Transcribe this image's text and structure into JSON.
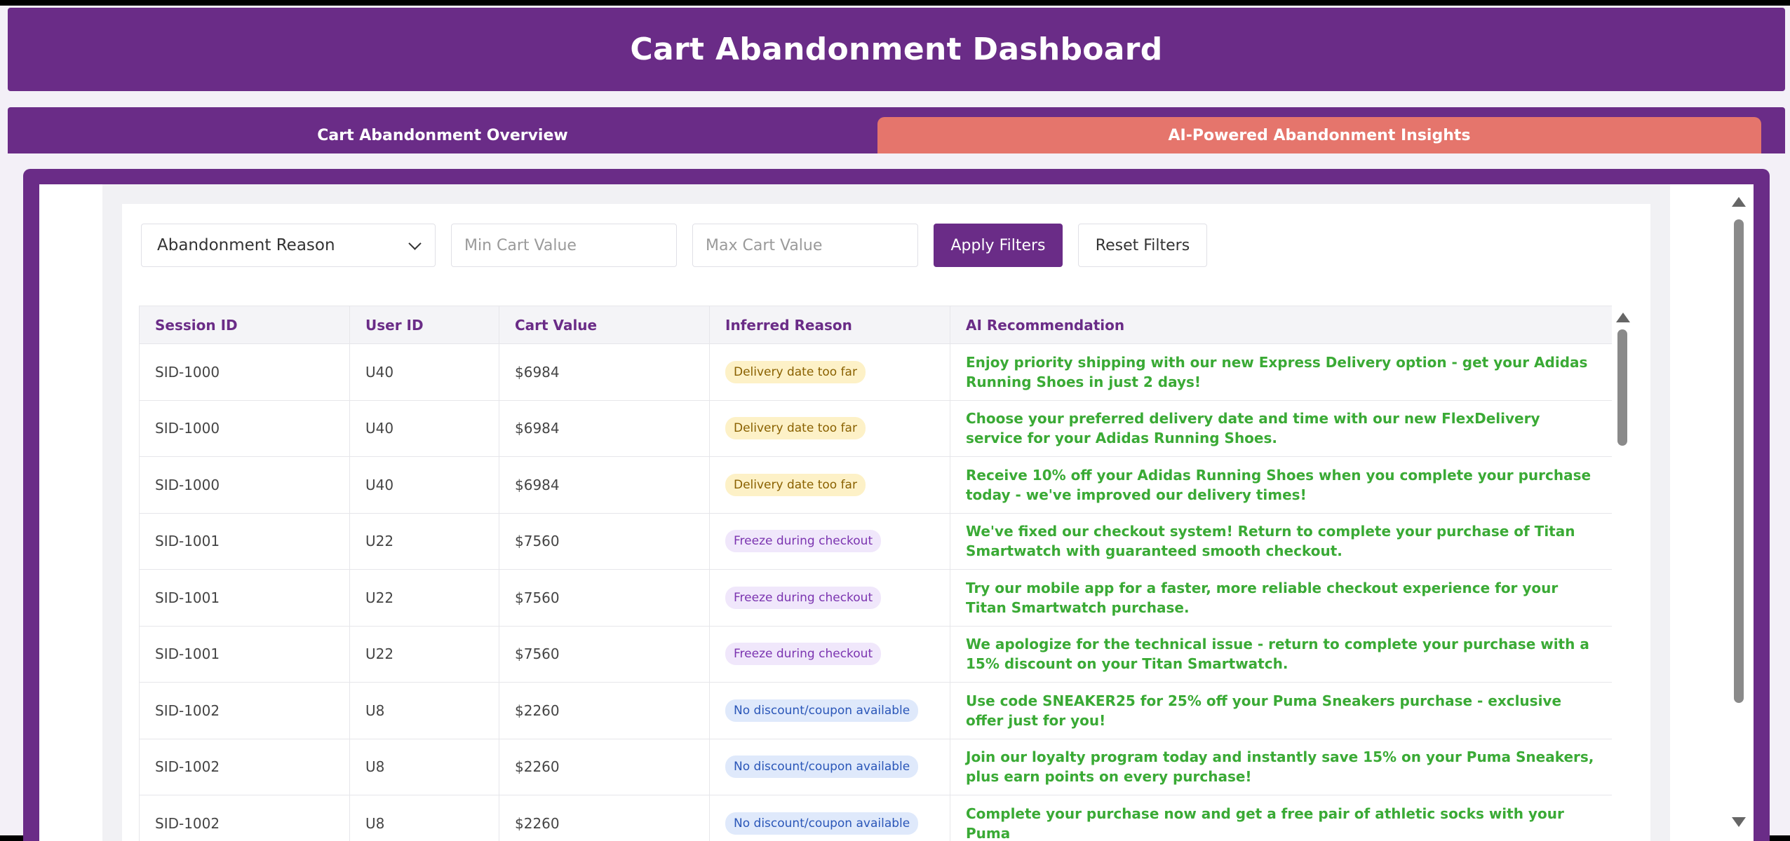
{
  "header": {
    "title": "Cart Abandonment Dashboard"
  },
  "tabs": [
    {
      "label": "Cart Abandonment Overview",
      "active": false
    },
    {
      "label": "AI-Powered Abandonment Insights",
      "active": true
    }
  ],
  "filters": {
    "reason_select": "Abandonment Reason",
    "min_placeholder": "Min Cart Value",
    "max_placeholder": "Max Cart Value",
    "apply_label": "Apply Filters",
    "reset_label": "Reset Filters"
  },
  "table": {
    "columns": [
      "Session ID",
      "User ID",
      "Cart Value",
      "Inferred Reason",
      "AI Recommendation"
    ],
    "rows": [
      {
        "session": "SID-1000",
        "user": "U40",
        "value": "$6984",
        "reason": "Delivery date too far",
        "reason_type": "delivery",
        "recommendation": "Enjoy priority shipping with our new Express Delivery option - get your Adidas Running Shoes in just 2 days!"
      },
      {
        "session": "SID-1000",
        "user": "U40",
        "value": "$6984",
        "reason": "Delivery date too far",
        "reason_type": "delivery",
        "recommendation": "Choose your preferred delivery date and time with our new FlexDelivery service for your Adidas Running Shoes."
      },
      {
        "session": "SID-1000",
        "user": "U40",
        "value": "$6984",
        "reason": "Delivery date too far",
        "reason_type": "delivery",
        "recommendation": "Receive 10% off your Adidas Running Shoes when you complete your purchase today - we've improved our delivery times!"
      },
      {
        "session": "SID-1001",
        "user": "U22",
        "value": "$7560",
        "reason": "Freeze during checkout",
        "reason_type": "freeze",
        "recommendation": "We've fixed our checkout system! Return to complete your purchase of Titan Smartwatch with guaranteed smooth checkout."
      },
      {
        "session": "SID-1001",
        "user": "U22",
        "value": "$7560",
        "reason": "Freeze during checkout",
        "reason_type": "freeze",
        "recommendation": "Try our mobile app for a faster, more reliable checkout experience for your Titan Smartwatch purchase."
      },
      {
        "session": "SID-1001",
        "user": "U22",
        "value": "$7560",
        "reason": "Freeze during checkout",
        "reason_type": "freeze",
        "recommendation": "We apologize for the technical issue - return to complete your purchase with a 15% discount on your Titan Smartwatch."
      },
      {
        "session": "SID-1002",
        "user": "U8",
        "value": "$2260",
        "reason": "No discount/coupon available",
        "reason_type": "discount",
        "recommendation": "Use code SNEAKER25 for 25% off your Puma Sneakers purchase - exclusive offer just for you!"
      },
      {
        "session": "SID-1002",
        "user": "U8",
        "value": "$2260",
        "reason": "No discount/coupon available",
        "reason_type": "discount",
        "recommendation": "Join our loyalty program today and instantly save 15% on your Puma Sneakers, plus earn points on every purchase!"
      },
      {
        "session": "SID-1002",
        "user": "U8",
        "value": "$2260",
        "reason": "No discount/coupon available",
        "reason_type": "discount",
        "recommendation": "Complete your purchase now and get a free pair of athletic socks with your Puma"
      }
    ]
  },
  "colors": {
    "primary": "#6a2c87",
    "active_tab": "#e5756c",
    "recommendation_text": "#3aaa35"
  }
}
